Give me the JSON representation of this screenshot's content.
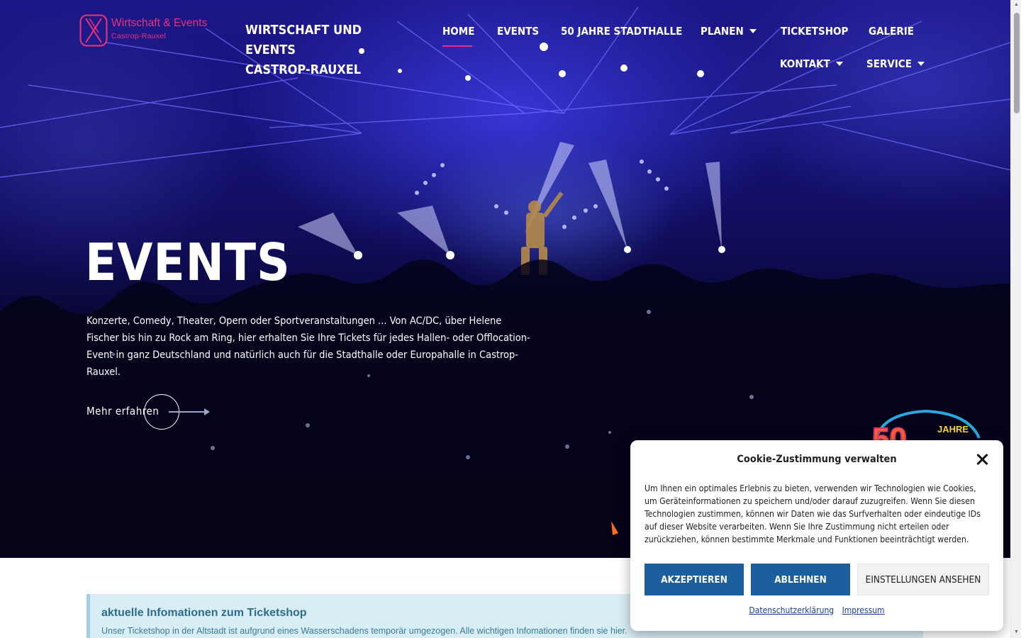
{
  "header": {
    "logo_text": "Wirtschaft & Events",
    "logo_sub": "Castrop-Rauxel",
    "site_title_line1": "WIRTSCHAFT UND",
    "site_title_line2": "EVENTS",
    "site_title_line3": "CASTROP-RAUXEL"
  },
  "nav": {
    "items": [
      {
        "label": "HOME",
        "active": true
      },
      {
        "label": "EVENTS"
      },
      {
        "label": "50 JAHRE STADTHALLE"
      },
      {
        "label": "PLANEN",
        "dropdown": true
      },
      {
        "label": "TICKETSHOP"
      },
      {
        "label": "GALERIE"
      },
      {
        "label": "KONTAKT",
        "dropdown": true
      },
      {
        "label": "SERVICE",
        "dropdown": true
      }
    ],
    "active_color": "#e8327a"
  },
  "hero": {
    "title": "EVENTS",
    "text": "Konzerte, Comedy, Theater, Opern oder Sportveranstaltungen ... Von AC/DC, über Helene Fischer bis hin zu Rock am Ring, hier erhalten Sie Ihre Tickets für jedes Hallen- oder Offlocation-Event in ganz Deutschland und natürlich auch für die Stadthalle oder Europahalle in Castrop-Rauxel.",
    "more_label": "Mehr erfahren"
  },
  "badge": {
    "number": "50",
    "label": "JAHRE"
  },
  "notice": {
    "title": "aktuelle Infomationen zum Ticketshop",
    "text": "Unser Ticketshop in der Altstadt ist aufgrund eines Wasserschadens temporär umgezogen. Alle wichtigen Infomationen finden sie hier."
  },
  "cookie": {
    "title": "Cookie-Zustimmung verwalten",
    "body": "Um Ihnen ein optimales Erlebnis zu bieten, verwenden wir Technologien wie Cookies, um Geräteinformationen zu speichern und/oder darauf zuzugreifen. Wenn Sie diesen Technologien zustimmen, können wir Daten wie das Surfverhalten oder eindeutige IDs auf dieser Website verarbeiten. Wenn Sie Ihre Zustimmung nicht erteilen oder zurückziehen, können bestimmte Merkmale und Funktionen beeinträchtigt werden.",
    "accept_label": "AKZEPTIEREN",
    "deny_label": "ABLEHNEN",
    "settings_label": "EINSTELLUNGEN ANSEHEN",
    "privacy_link": "Datenschutzerklärung",
    "imprint_link": "Impressum",
    "button_color": "#1c5f9e"
  }
}
